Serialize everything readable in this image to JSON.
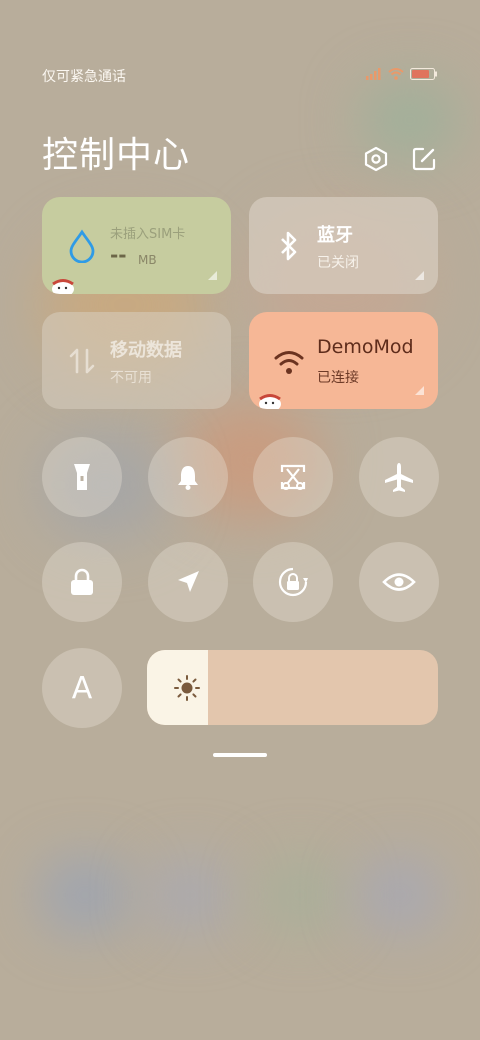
{
  "status_bar": {
    "carrier_text": "仅可紧急通话",
    "icons": [
      "signal-icon",
      "wifi-icon",
      "battery-icon"
    ]
  },
  "header": {
    "title": "控制中心",
    "icons": [
      "settings-icon",
      "edit-icon"
    ]
  },
  "tiles": {
    "data_usage": {
      "title": "未插入SIM卡",
      "value": "--",
      "unit": "MB",
      "icon": "water-drop-icon",
      "bg_color": "#c6cc9f"
    },
    "bluetooth": {
      "title": "蓝牙",
      "status": "已关闭",
      "icon": "bluetooth-icon"
    },
    "mobile_data": {
      "title": "移动数据",
      "status": "不可用",
      "icon": "mobile-data-icon"
    },
    "wifi": {
      "title": "DemoMod",
      "status": "已连接",
      "icon": "wifi-icon",
      "bg_color": "#f6b796"
    }
  },
  "toggles_row1": [
    "flashlight-icon",
    "bell-icon",
    "screenshot-icon",
    "airplane-icon"
  ],
  "toggles_row2": [
    "lock-icon",
    "location-icon",
    "rotation-lock-icon",
    "eye-icon"
  ],
  "font_button": {
    "label": "A"
  },
  "brightness": {
    "level": 0.21,
    "icon": "sun-icon"
  },
  "colors": {
    "accent_wifi": "#f6b796",
    "accent_data": "#c6cc9f",
    "brightness_track": "#e3c6ad"
  }
}
